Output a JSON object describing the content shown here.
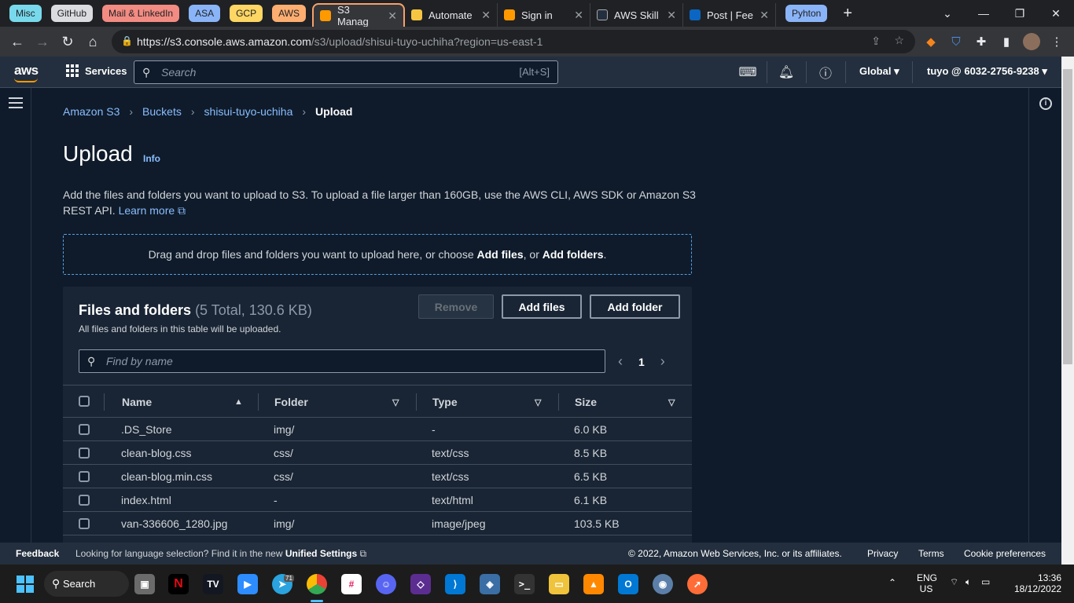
{
  "browser": {
    "tab_groups": [
      {
        "label": "Misc",
        "color": "#78d9ec"
      },
      {
        "label": "GitHub",
        "color": "#dadce0"
      },
      {
        "label": "Mail & LinkedIn",
        "color": "#f28b82"
      },
      {
        "label": "ASA",
        "color": "#8ab4f8"
      },
      {
        "label": "GCP",
        "color": "#fdd663"
      },
      {
        "label": "AWS",
        "color": "#fcad70"
      },
      {
        "label": "Pyhton",
        "color": "#8ab4f8"
      }
    ],
    "tabs": [
      {
        "label": "S3 Manag",
        "active": true
      },
      {
        "label": "Automate"
      },
      {
        "label": "Sign in"
      },
      {
        "label": "AWS Skill"
      },
      {
        "label": "Post | Fee"
      }
    ],
    "url_host": "https://s3.console.aws.amazon.com",
    "url_path": "/s3/upload/shisui-tuyo-uchiha?region=us-east-1"
  },
  "aws_nav": {
    "logo": "aws",
    "services": "Services",
    "search_placeholder": "Search",
    "search_shortcut": "[Alt+S]",
    "region": "Global",
    "account": "tuyo @ 6032-2756-9238"
  },
  "breadcrumb": {
    "items": [
      "Amazon S3",
      "Buckets",
      "shisui-tuyo-uchiha"
    ],
    "current": "Upload"
  },
  "page": {
    "title": "Upload",
    "info": "Info",
    "description": "Add the files and folders you want to upload to S3. To upload a file larger than 160GB, use the AWS CLI, AWS SDK or Amazon S3 REST API.",
    "learn_more": "Learn more",
    "dropzone_pre": "Drag and drop files and folders you want to upload here, or choose ",
    "dropzone_add_files": "Add files",
    "dropzone_mid": ", or ",
    "dropzone_add_folders": "Add folders",
    "dropzone_end": "."
  },
  "files_panel": {
    "title": "Files and folders",
    "count": "(5 Total, 130.6 KB)",
    "subtitle": "All files and folders in this table will be uploaded.",
    "remove_label": "Remove",
    "add_files_label": "Add files",
    "add_folder_label": "Add folder",
    "find_placeholder": "Find by name",
    "page": "1",
    "columns": [
      "Name",
      "Folder",
      "Type",
      "Size"
    ],
    "rows": [
      {
        "name": ".DS_Store",
        "folder": "img/",
        "type": "-",
        "size": "6.0 KB"
      },
      {
        "name": "clean-blog.css",
        "folder": "css/",
        "type": "text/css",
        "size": "8.5 KB"
      },
      {
        "name": "clean-blog.min.css",
        "folder": "css/",
        "type": "text/css",
        "size": "6.5 KB"
      },
      {
        "name": "index.html",
        "folder": "-",
        "type": "text/html",
        "size": "6.1 KB"
      },
      {
        "name": "van-336606_1280.jpg",
        "folder": "img/",
        "type": "image/jpeg",
        "size": "103.5 KB"
      }
    ]
  },
  "footer": {
    "feedback": "Feedback",
    "language_text": "Looking for language selection? Find it in the new ",
    "unified_settings": "Unified Settings",
    "copyright": "© 2022, Amazon Web Services, Inc. or its affiliates.",
    "privacy": "Privacy",
    "terms": "Terms",
    "cookie": "Cookie preferences"
  },
  "taskbar": {
    "search": "Search",
    "telegram_badge": "71",
    "lang_top": "ENG",
    "lang_bottom": "US",
    "time": "13:36",
    "date": "18/12/2022"
  }
}
